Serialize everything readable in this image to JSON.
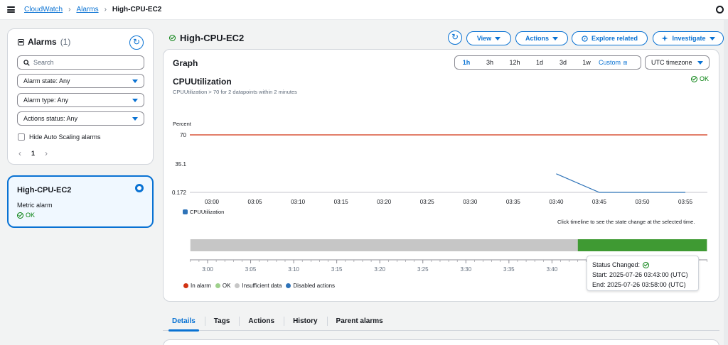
{
  "breadcrumb": {
    "items": [
      "CloudWatch",
      "Alarms",
      "High-CPU-EC2"
    ]
  },
  "sidebar": {
    "title": "Alarms",
    "count": "(1)",
    "search_placeholder": "Search",
    "filters": {
      "alarm_state": "Alarm state: Any",
      "alarm_type": "Alarm type: Any",
      "actions_status": "Actions status: Any"
    },
    "hide_autoscaling_label": "Hide Auto Scaling alarms",
    "hide_autoscaling_checked": false,
    "page": "1",
    "prev_glyph": "‹",
    "next_glyph": "›",
    "alarm_card": {
      "name": "High-CPU-EC2",
      "type": "Metric alarm",
      "state": "OK",
      "selected": true
    }
  },
  "header": {
    "title": "High-CPU-EC2",
    "buttons": {
      "refresh_glyph": "↻",
      "view": "View",
      "actions": "Actions",
      "explore": "Explore related",
      "investigate": "Investigate"
    }
  },
  "graph": {
    "heading": "Graph",
    "time_ranges": [
      "1h",
      "3h",
      "12h",
      "1d",
      "3d",
      "1w"
    ],
    "selected_range": "1h",
    "custom_label": "Custom",
    "timezone": "UTC timezone",
    "metric_title": "CPUUtilization",
    "metric_subtitle": "CPUUtilization > 70 for 2 datapoints within 2 minutes",
    "state": "OK",
    "timeline_hint": "Click timeline to see the state change at the selected time."
  },
  "chart_data": {
    "type": "line",
    "ylabel": "Percent",
    "y_ticks": [
      "70",
      "35.1",
      "0.172"
    ],
    "x_ticks": [
      "03:00",
      "03:05",
      "03:10",
      "03:15",
      "03:20",
      "03:25",
      "03:30",
      "03:35",
      "03:40",
      "03:45",
      "03:50",
      "03:55"
    ],
    "threshold": {
      "value": 70,
      "color": "#d13212"
    },
    "series": [
      {
        "name": "CPUUtilization",
        "color": "#2e73b8",
        "x": [
          "03:40",
          "03:45",
          "03:50",
          "03:55"
        ],
        "values": [
          23,
          0.172,
          0.172,
          0.172
        ]
      }
    ],
    "legend_position": "bottom-left"
  },
  "timeline": {
    "x_ticks": [
      "3:00",
      "3:05",
      "3:10",
      "3:15",
      "3:20",
      "3:25",
      "3:30",
      "3:35",
      "3:40",
      "3:45",
      "3:50",
      "3:55"
    ],
    "segments": [
      {
        "state": "Insufficient data",
        "from": "02:58",
        "to": "03:43",
        "color": "#c6c6c6"
      },
      {
        "state": "OK",
        "from": "03:43",
        "to": "03:58",
        "color": "#3f9a33"
      }
    ],
    "legend": [
      {
        "label": "In alarm",
        "color": "#d13212"
      },
      {
        "label": "OK",
        "color": "#9ed08b"
      },
      {
        "label": "Insufficient data",
        "color": "#c6c6c6"
      },
      {
        "label": "Disabled actions",
        "color": "#2e73b8"
      }
    ],
    "tooltip": {
      "title": "Status Changed:",
      "start_label": "Start:",
      "start": "2025-07-26 03:43:00 (UTC)",
      "end_label": "End:",
      "end": "2025-07-26 03:58:00 (UTC)"
    }
  },
  "tabs": {
    "items": [
      "Details",
      "Tags",
      "Actions",
      "History",
      "Parent alarms"
    ],
    "active": "Details"
  }
}
